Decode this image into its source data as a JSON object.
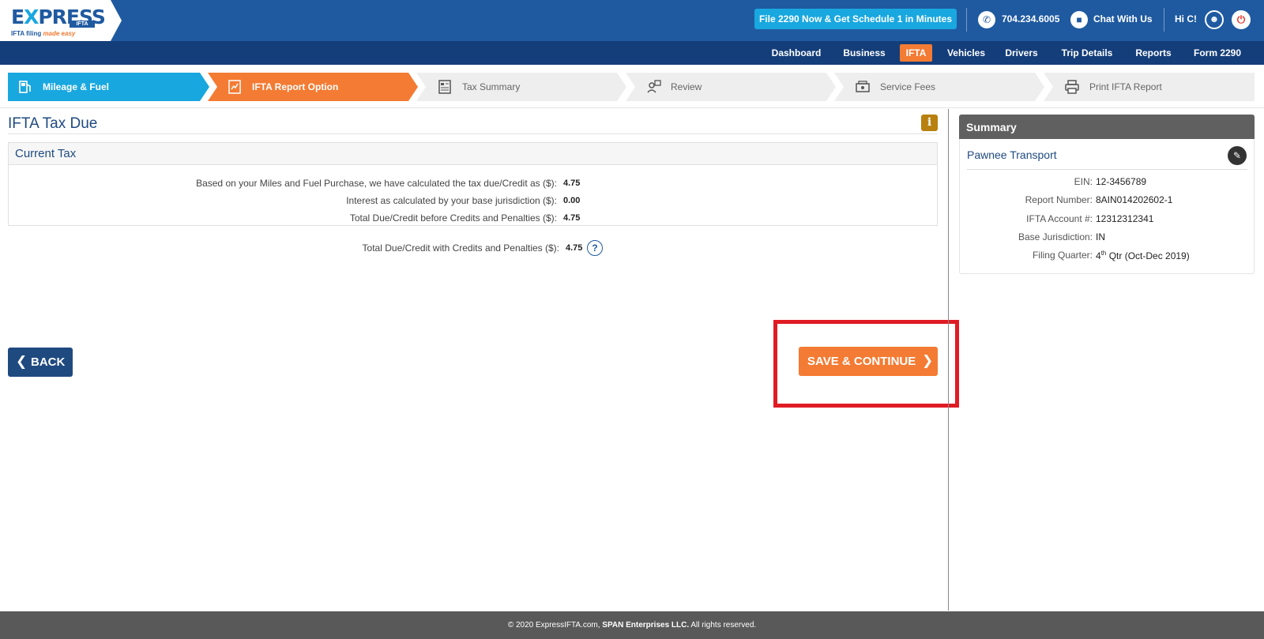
{
  "header": {
    "logo_text_a": "E",
    "logo_text_x": "X",
    "logo_text_b": "PRESS",
    "logo_sub": "IFTA",
    "logo_tag_a": "IFTA filing ",
    "logo_tag_b": "made easy",
    "promo_label": "File 2290 Now & Get Schedule 1 in Minutes",
    "phone": "704.234.6005",
    "chat_label": "Chat With Us",
    "greeting": "Hi C!"
  },
  "nav": {
    "items": [
      {
        "label": "Dashboard"
      },
      {
        "label": "Business"
      },
      {
        "label": "IFTA"
      },
      {
        "label": "Vehicles"
      },
      {
        "label": "Drivers"
      },
      {
        "label": "Trip Details"
      },
      {
        "label": "Reports"
      },
      {
        "label": "Form 2290"
      }
    ],
    "active": "IFTA"
  },
  "steps": [
    {
      "label": "Mileage & Fuel",
      "state": "done",
      "icon": "fuel-pump-icon"
    },
    {
      "label": "IFTA Report Option",
      "state": "current",
      "icon": "report-icon"
    },
    {
      "label": "Tax Summary",
      "state": "pending",
      "icon": "summary-icon"
    },
    {
      "label": "Review",
      "state": "pending",
      "icon": "review-icon"
    },
    {
      "label": "Service Fees",
      "state": "pending",
      "icon": "fees-icon"
    },
    {
      "label": "Print IFTA Report",
      "state": "pending",
      "icon": "printer-icon"
    }
  ],
  "main": {
    "title": "IFTA Tax Due",
    "current_tax": {
      "heading": "Current Tax",
      "rows": [
        {
          "label": "Based on your Miles and Fuel Purchase, we have calculated the tax due/Credit as ($):",
          "value": "4.75"
        },
        {
          "label": "Interest as calculated by your base jurisdiction ($):",
          "value": "0.00"
        },
        {
          "label": "Total Due/Credit before Credits and Penalties ($):",
          "value": "4.75"
        }
      ]
    },
    "total_with_credits": {
      "label": "Total Due/Credit with Credits and Penalties ($):",
      "value": "4.75"
    },
    "back_label": "BACK",
    "save_label": "SAVE & CONTINUE"
  },
  "summary": {
    "heading": "Summary",
    "company": "Pawnee Transport",
    "rows": [
      {
        "label": "EIN:",
        "value": "12-3456789"
      },
      {
        "label": "Report Number:",
        "value": "8AIN014202602-1"
      },
      {
        "label": "IFTA Account #:",
        "value": "12312312341"
      },
      {
        "label": "Base Jurisdiction:",
        "value": "IN"
      }
    ],
    "quarter_label": "Filing Quarter:",
    "quarter_num": "4",
    "quarter_sup": "th",
    "quarter_rest": " Qtr (Oct-Dec 2019)"
  },
  "footer": {
    "prefix": "© 2020 ExpressIFTA.com, ",
    "company": "SPAN Enterprises LLC.",
    "suffix": " All rights reserved."
  },
  "colors": {
    "brand_blue": "#1f5aa0",
    "nav_blue": "#143e7a",
    "accent_orange": "#f47b33",
    "step_done": "#19a7e0",
    "highlight_red": "#e01b24"
  }
}
